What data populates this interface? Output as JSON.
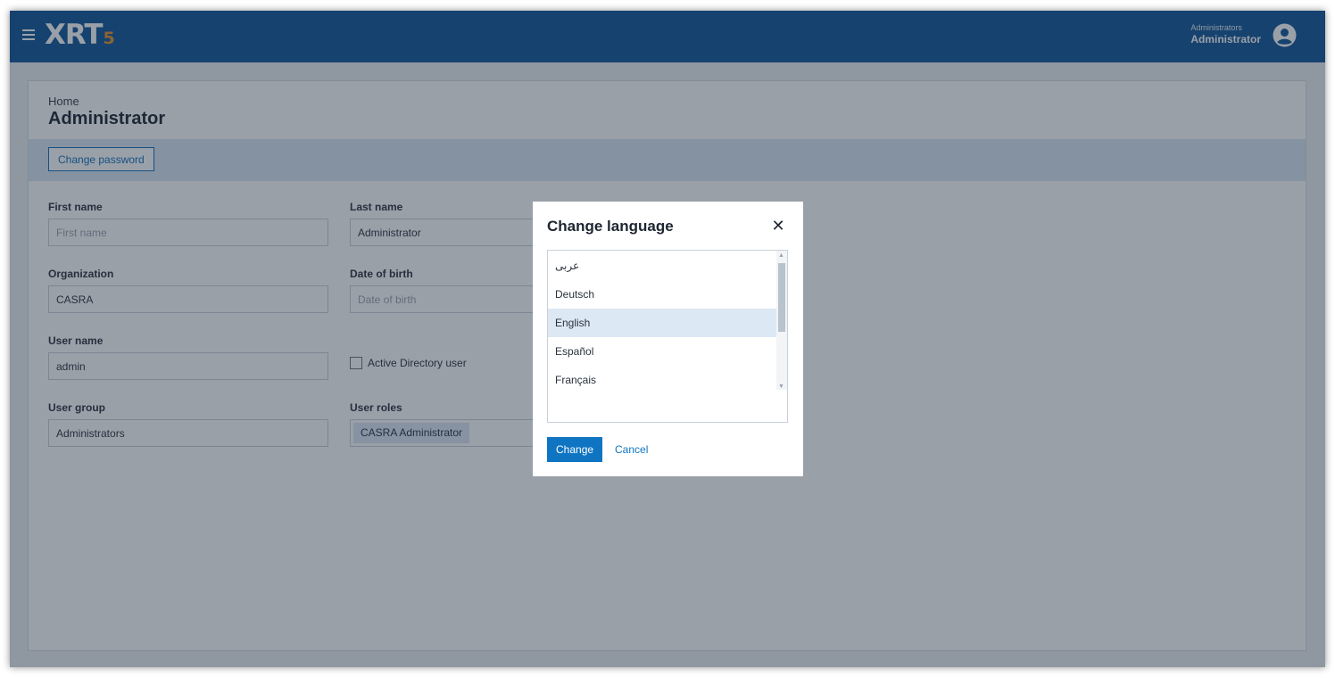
{
  "header": {
    "logo_text": "XRT",
    "logo_version": "5",
    "user_group": "Administrators",
    "user_name": "Administrator"
  },
  "page": {
    "breadcrumb": "Home",
    "title": "Administrator",
    "change_password_label": "Change password"
  },
  "form": {
    "first_name": {
      "label": "First name",
      "value": "",
      "placeholder": "First name"
    },
    "last_name": {
      "label": "Last name",
      "value": "Administrator",
      "placeholder": ""
    },
    "organization": {
      "label": "Organization",
      "value": "CASRA",
      "placeholder": ""
    },
    "date_of_birth": {
      "label": "Date of birth",
      "value": "",
      "placeholder": "Date of birth"
    },
    "user_name": {
      "label": "User name",
      "value": "admin",
      "placeholder": ""
    },
    "active_directory": {
      "label": "Active Directory user",
      "checked": false
    },
    "user_group": {
      "label": "User group",
      "value": "Administrators",
      "placeholder": ""
    },
    "user_roles": {
      "label": "User roles",
      "items": [
        "CASRA Administrator"
      ]
    }
  },
  "modal": {
    "title": "Change language",
    "options": [
      "عربى",
      "Deutsch",
      "English",
      "Español",
      "Français"
    ],
    "selected": "English",
    "change_label": "Change",
    "cancel_label": "Cancel"
  },
  "colors": {
    "brand": "#0f5597",
    "accent": "#e8912d",
    "primary_button": "#0f75c3",
    "selected_option": "#dce8f4"
  }
}
